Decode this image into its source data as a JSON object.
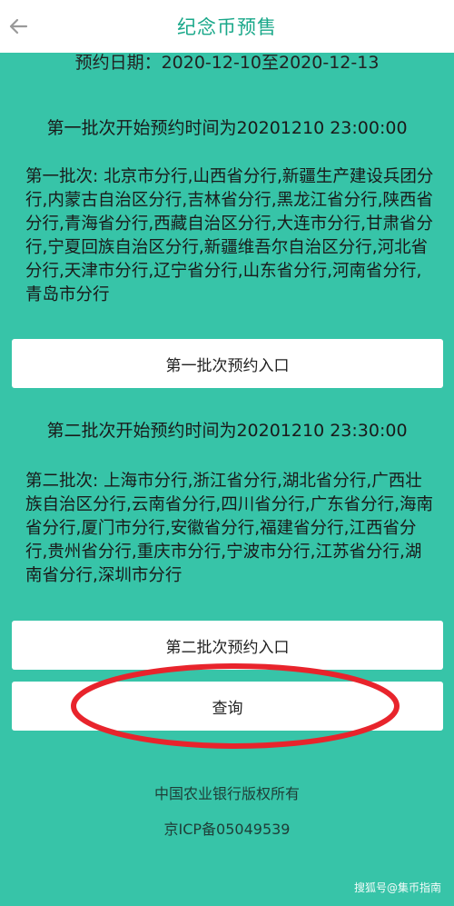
{
  "header": {
    "title": "纪念币预售",
    "back_icon": "arrow-left-icon"
  },
  "reservation_date": "预约日期：2020-12-10至2020-12-13",
  "batch1": {
    "heading": "第一批次开始预约时间为20201210 23:00:00",
    "branches": "第一批次: 北京市分行,山西省分行,新疆生产建设兵团分行,内蒙古自治区分行,吉林省分行,黑龙江省分行,陕西省分行,青海省分行,西藏自治区分行,大连市分行,甘肃省分行,宁夏回族自治区分行,新疆维吾尔自治区分行,河北省分行,天津市分行,辽宁省分行,山东省分行,河南省分行,青岛市分行",
    "button_label": "第一批次预约入口"
  },
  "batch2": {
    "heading": "第二批次开始预约时间为20201210 23:30:00",
    "branches": "第二批次: 上海市分行,浙江省分行,湖北省分行,广西壮族自治区分行,云南省分行,四川省分行,广东省分行,海南省分行,厦门市分行,安徽省分行,福建省分行,江西省分行,贵州省分行,重庆市分行,宁波市分行,江苏省分行,湖南省分行,深圳市分行",
    "button_label": "第二批次预约入口"
  },
  "query_button_label": "查询",
  "footer": {
    "copyright": "中国农业银行版权所有",
    "icp": "京ICP备05049539"
  },
  "watermark": "搜狐号@集币指南",
  "colors": {
    "background": "#37c4a8",
    "title": "#1aa88a",
    "annotation": "#e8242c"
  }
}
